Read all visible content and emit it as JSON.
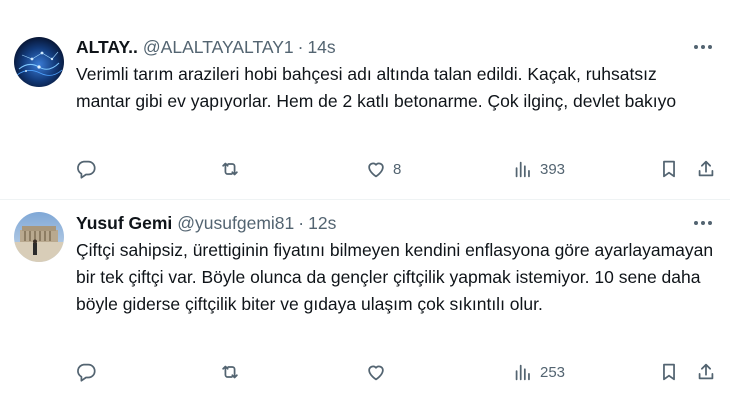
{
  "tweets": [
    {
      "name": "ALTAY..",
      "handle": "@ALALTAYALTAY1",
      "separator": "·",
      "time": "14s",
      "text": "Verimli tarım arazileri hobi bahçesi adı altında talan edildi. Kaçak, ruhsatsız mantar gibi ev yapıyorlar. Hem de 2 katlı betonarme. Çok ilginç, devlet bakıyo",
      "replies": "",
      "retweets": "",
      "likes": "8",
      "views": "393",
      "avatar_icon": "blue-digital-network-avatar"
    },
    {
      "name": "Yusuf Gemi",
      "handle": "@yusufgemi81",
      "separator": "·",
      "time": "12s",
      "text": "Çiftçi sahipsiz, ürettiginin fiyatını bilmeyen kendini enflasyona göre ayarlayamayan bir tek çiftçi var. Böyle olunca da gençler çiftçilik yapmak istemiyor. 10 sene daha böyle giderse çiftçilik biter ve gıdaya ulaşım çok sıkıntılı olur.",
      "replies": "",
      "retweets": "",
      "likes": "",
      "views": "253",
      "avatar_icon": "monument-photo-avatar"
    }
  ],
  "icons": {
    "more": "more-horizontal-icon",
    "reply": "reply-bubble-icon",
    "retweet": "retweet-icon",
    "like": "heart-icon",
    "views": "views-bar-chart-icon",
    "bookmark": "bookmark-icon",
    "share": "share-upload-icon"
  },
  "colors": {
    "text": "#0f1419",
    "secondary": "#536471",
    "divider": "#eff3f4"
  }
}
